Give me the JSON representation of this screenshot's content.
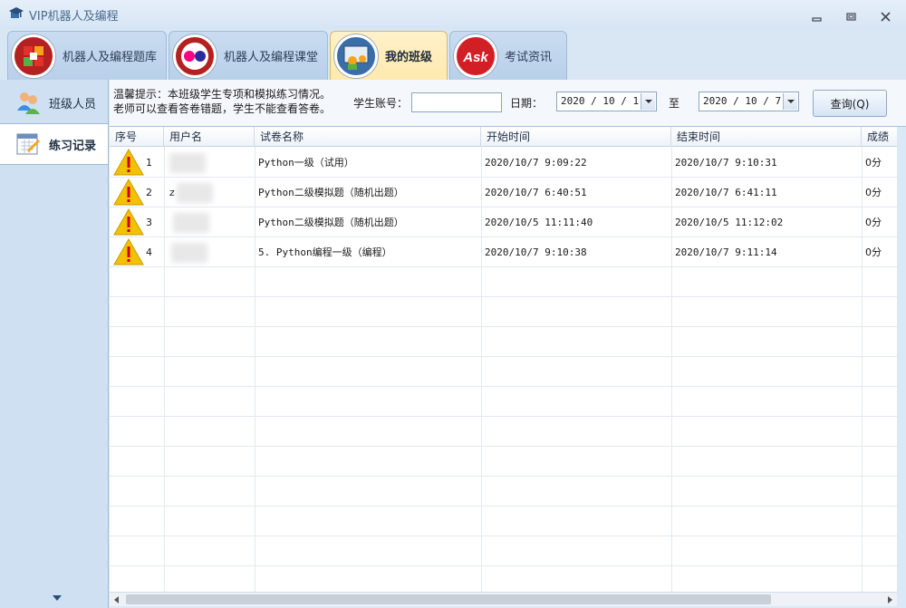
{
  "window": {
    "title": "VIP机器人及编程"
  },
  "tabs": [
    {
      "label": "机器人及编程题库",
      "icon": "puzzle-icon"
    },
    {
      "label": "机器人及编程课堂",
      "icon": "flickr-dots-icon"
    },
    {
      "label": "我的班级",
      "icon": "class-icon",
      "active": true
    },
    {
      "label": "考试资讯",
      "icon": "ask-icon"
    }
  ],
  "sidebar": {
    "items": [
      {
        "label": "班级人员",
        "icon": "users-icon"
      },
      {
        "label": "练习记录",
        "icon": "calendar-icon",
        "active": true
      }
    ]
  },
  "filter": {
    "tip_line1": "温馨提示：本班级学生专项和模拟练习情况。",
    "tip_line2": "老师可以查看答卷错题，学生不能查看答卷。",
    "account_label": "学生账号：",
    "account_value": "",
    "date_label": "日期：",
    "date_from": "2020 / 10 / 1",
    "to_label": "至",
    "date_to": "2020 / 10 / 7",
    "query_label": "查询(Q)"
  },
  "table": {
    "columns": [
      "序号",
      "用户名",
      "试卷名称",
      "开始时间",
      "结束时间",
      "成绩"
    ],
    "rows": [
      {
        "index": "1",
        "user": "",
        "paper": "Python一级（试用）",
        "start": "2020/10/7 9:09:22",
        "end": "2020/10/7 9:10:31",
        "score": "0分"
      },
      {
        "index": "2",
        "user": "z",
        "paper": "Python二级模拟题（随机出题）",
        "start": "2020/10/7 6:40:51",
        "end": "2020/10/7 6:41:11",
        "score": "0分"
      },
      {
        "index": "3",
        "user": "",
        "paper": "Python二级模拟题（随机出题）",
        "start": "2020/10/5 11:11:40",
        "end": "2020/10/5 11:12:02",
        "score": "0分"
      },
      {
        "index": "4",
        "user": "",
        "paper": "5. Python编程一级（编程）",
        "start": "2020/10/7 9:10:38",
        "end": "2020/10/7 9:11:14",
        "score": "0分"
      }
    ]
  },
  "colors": {
    "accent": "#ffe9b0",
    "warning": "#f2c200"
  }
}
